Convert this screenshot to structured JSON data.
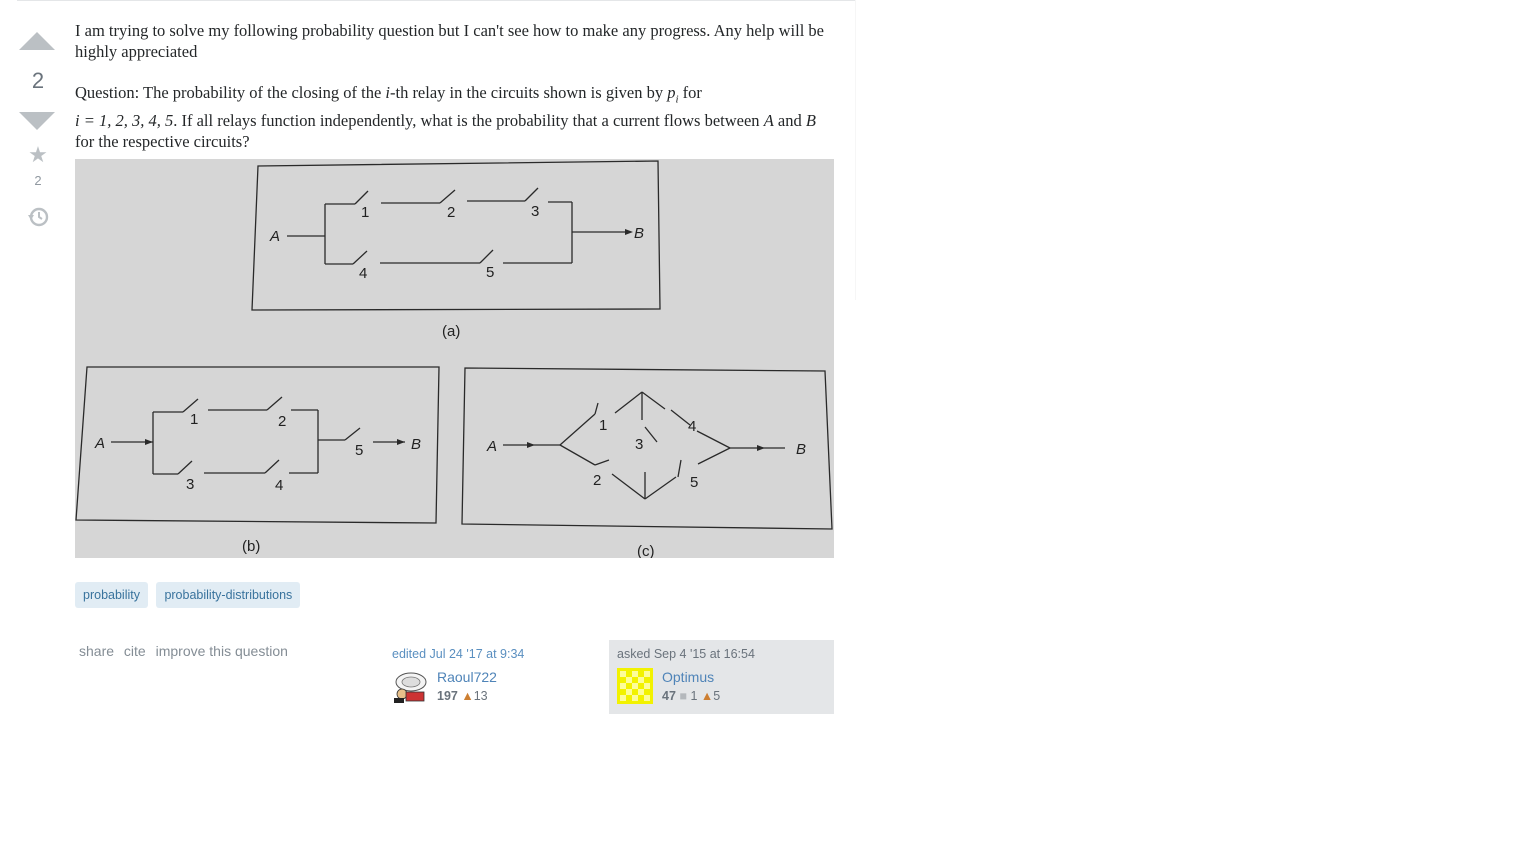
{
  "question": {
    "vote_count": "2",
    "favorite_count": "2",
    "intro": "I am trying to solve my following probability question but I can't see how to make any progress. Any help will be highly appreciated",
    "q_part1": "Question: The probability of the closing of the ",
    "q_math_i": "i",
    "q_part2": "-th relay in the circuits shown is given by ",
    "q_math_pi": "p",
    "q_math_sub": "i",
    "q_part3": " for",
    "q_math_range": "i = 1, 2, 3, 4, 5",
    "q_part4": ". If all relays function independently, what is the probability that a current flows between ",
    "q_math_A": "A",
    "q_part5": " and ",
    "q_math_B": "B",
    "q_part6": " for the respective circuits?"
  },
  "figure": {
    "labels_a": {
      "A": "A",
      "B": "B",
      "r1": "1",
      "r2": "2",
      "r3": "3",
      "r4": "4",
      "r5": "5",
      "caption": "(a)"
    },
    "labels_b": {
      "A": "A",
      "B": "B",
      "r1": "1",
      "r2": "2",
      "r3": "3",
      "r4": "4",
      "r5": "5",
      "caption": "(b)"
    },
    "labels_c": {
      "A": "A",
      "B": "B",
      "r1": "1",
      "r2": "2",
      "r3": "3",
      "r4": "4",
      "r5": "5",
      "caption": "(c)"
    }
  },
  "tags": [
    "probability",
    "probability-distributions"
  ],
  "menu": {
    "share": "share",
    "cite": "cite",
    "improve": "improve this question"
  },
  "edited": {
    "action": "edited Jul 24 '17 at 9:34",
    "user": "Raoul722",
    "rep": "197",
    "bronze_badges": "13",
    "avatar_icon": "avatar-icon"
  },
  "asked": {
    "action": "asked Sep 4 '15 at 16:54",
    "user": "Optimus",
    "rep": "47",
    "silver_badges": "1",
    "bronze_badges": "5",
    "avatar_icon": "identicon-icon"
  },
  "colors": {
    "tag_bg": "#e1ecf4",
    "tag_text": "#39739d",
    "link": "#4f84b8",
    "bronze": "#cd7f32"
  }
}
